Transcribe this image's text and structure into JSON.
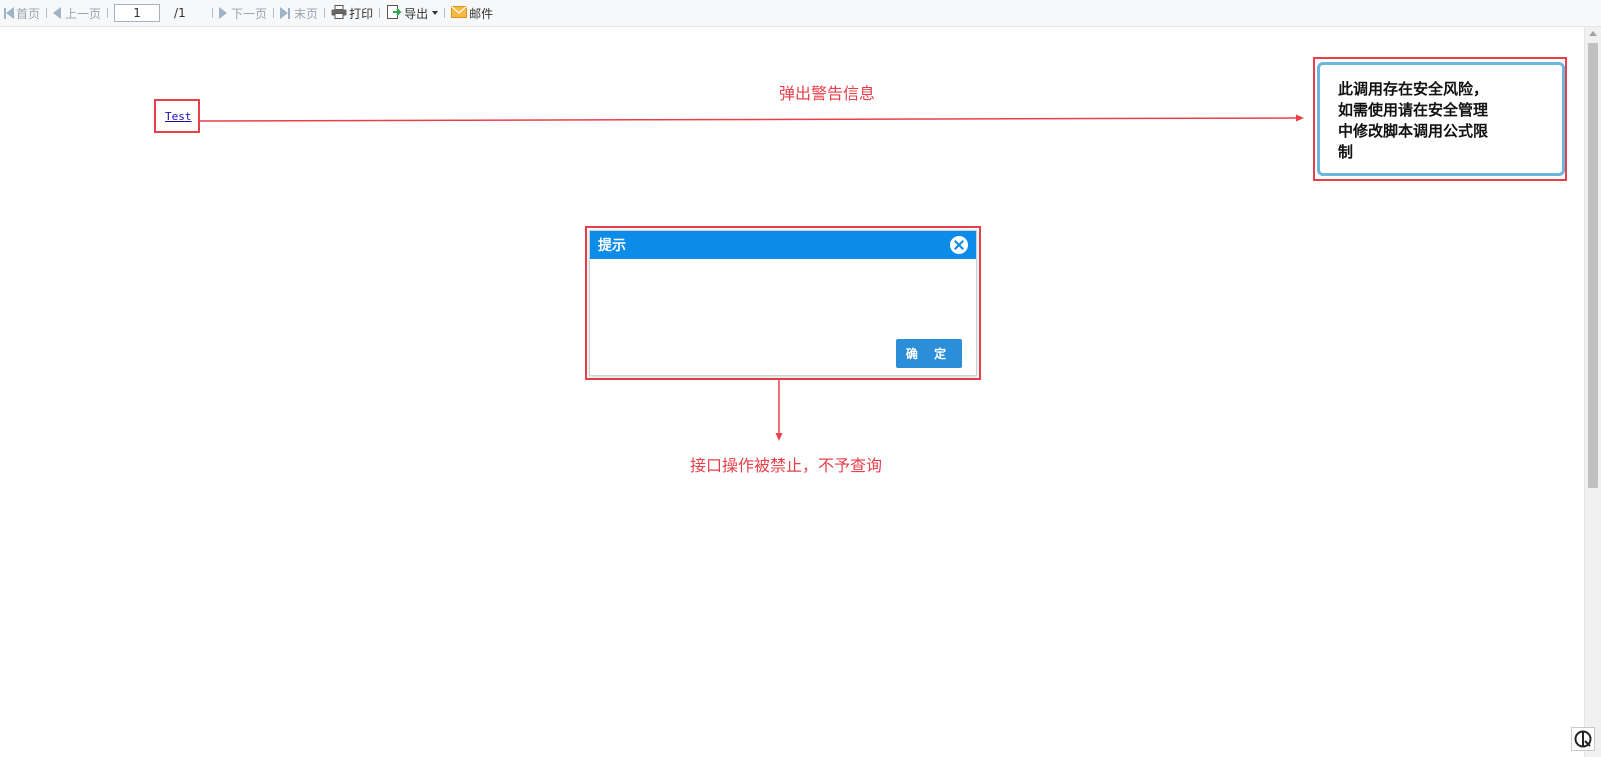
{
  "toolbar": {
    "first_label": "首页",
    "prev_label": "上一页",
    "page_value": "1",
    "page_total": "/1",
    "next_label": "下一页",
    "last_label": "末页",
    "print_label": "打印",
    "export_label": "导出",
    "mail_label": "邮件"
  },
  "report": {
    "link_text": "Test"
  },
  "annotations": {
    "top_label": "弹出警告信息",
    "bottom_label": "接口操作被禁止，不予查询"
  },
  "popup": {
    "line1": "此调用存在安全风险，",
    "line2": "如需使用请在安全管理",
    "line3": "中修改脚本调用公式限",
    "line4": "制"
  },
  "dialog": {
    "title": "提示",
    "ok_label": "确 定"
  },
  "colors": {
    "accent": "#0c8ce9",
    "annotation": "#e8404a",
    "popup_border": "#6ab6dd"
  }
}
